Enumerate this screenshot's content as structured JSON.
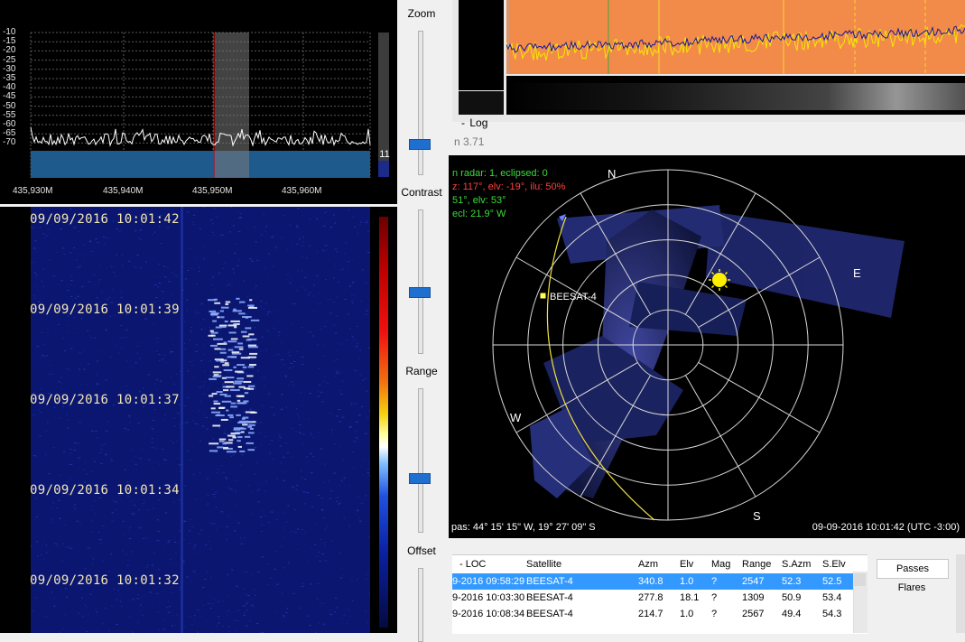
{
  "spectrum": {
    "y_labels": [
      "-10",
      "-15",
      "-20",
      "-25",
      "-30",
      "-35",
      "-40",
      "-45",
      "-50",
      "-55",
      "-60",
      "-65",
      "-70"
    ],
    "x_labels": [
      "435,930M",
      "435,940M",
      "435,950M",
      "435,960M"
    ],
    "level_value": "11",
    "colors": {
      "background": "#000000",
      "trace": "#ffffff",
      "noise_fill": "#1f5a8c",
      "marker": "#ff0000",
      "band": "#7a7a7a"
    }
  },
  "waterfall": {
    "timestamps": [
      "09/09/2016 10:01:42",
      "09/09/2016 10:01:39",
      "09/09/2016 10:01:37",
      "09/09/2016 10:01:34",
      "09/09/2016 10:01:32"
    ]
  },
  "controls": {
    "zoom_label": "Zoom",
    "contrast_label": "Contrast",
    "range_label": "Range",
    "offset_label": "Offset"
  },
  "top_panel": {
    "log_tab": "Log",
    "version_text": "n 3.71"
  },
  "radar": {
    "info_lines": [
      {
        "text": "n radar: 1, eclipsed: 0",
        "color": "#3cdc3c"
      },
      {
        "text": "z: 117°, elv: -19°, ilu: 50%",
        "color": "#ff4040"
      },
      {
        "text": "51°, elv: 53°",
        "color": "#3cdc3c"
      },
      {
        "text": "ecl: 21.9° W",
        "color": "#3cdc3c"
      }
    ],
    "compass": {
      "n": "N",
      "e": "E",
      "s": "S",
      "w": "W"
    },
    "satellite_label": "BEESAT-4",
    "location_text": "pas: 44° 15' 15\" W, 19° 27' 09\" S",
    "datetime_text": "09-09-2016 10:01:42 (UTC -3:00)"
  },
  "passes_table": {
    "headers": [
      "- LOC",
      "Satellite",
      "Azm",
      "Elv",
      "Mag",
      "Range",
      "S.Azm",
      "S.Elv"
    ],
    "rows": [
      {
        "time": "9-2016 09:58:29",
        "sat": "BEESAT-4",
        "azm": "340.8",
        "elv": "1.0",
        "mag": "?",
        "range": "2547",
        "sazm": "52.3",
        "selv": "52.5",
        "selected": true
      },
      {
        "time": "9-2016 10:03:30",
        "sat": "BEESAT-4",
        "azm": "277.8",
        "elv": "18.1",
        "mag": "?",
        "range": "1309",
        "sazm": "50.9",
        "selv": "53.4",
        "selected": false
      },
      {
        "time": "9-2016 10:08:34",
        "sat": "BEESAT-4",
        "azm": "214.7",
        "elv": "1.0",
        "mag": "?",
        "range": "2567",
        "sazm": "49.4",
        "selv": "54.3",
        "selected": false
      }
    ]
  },
  "side_panel": {
    "passes_label": "Passes",
    "flares_label": "Flares"
  }
}
